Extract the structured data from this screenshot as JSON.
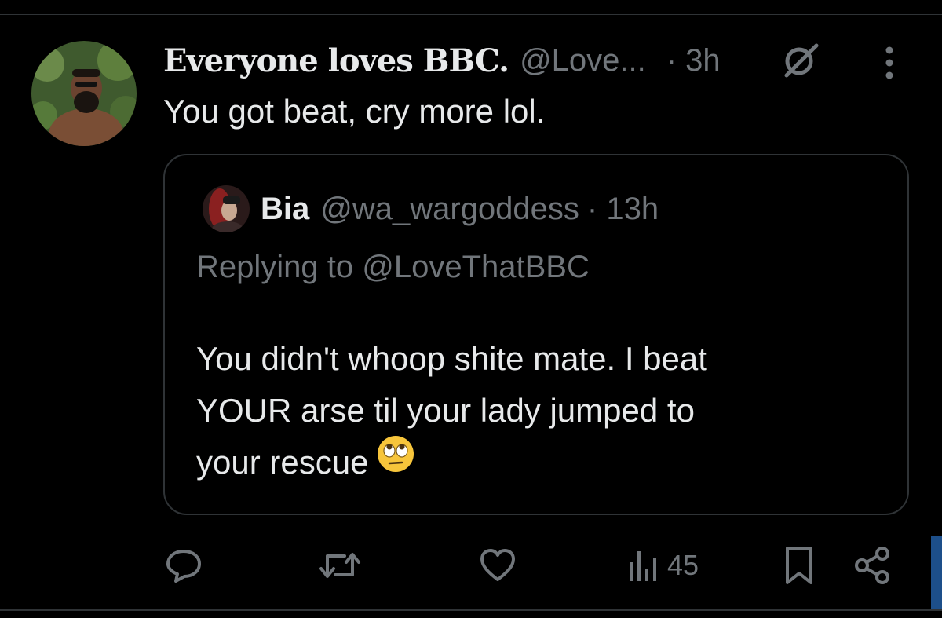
{
  "tweet": {
    "author": {
      "display_name": "Everyone loves BBC.",
      "handle": "@Love...",
      "avatar": "profile-photo"
    },
    "time": "· 3h",
    "text": "You got beat, cry more lol.",
    "quoted": {
      "author": {
        "display_name": "Bia",
        "handle": "@wa_wargoddess",
        "avatar": "profile-photo"
      },
      "time": "· 13h",
      "replying_prefix": "Replying to ",
      "replying_to": "@LoveThatBBC",
      "body_lines": [
        "You didn't whoop shite mate. I beat",
        "YOUR arse til your lady jumped to",
        "your rescue"
      ],
      "emoji": "face-with-rolling-eyes"
    },
    "actions": {
      "reply_icon": "speech-bubble-icon",
      "retweet_icon": "retweet-icon",
      "like_icon": "heart-icon",
      "views_icon": "bar-chart-icon",
      "views_count": "45",
      "bookmark_icon": "bookmark-icon",
      "share_icon": "share-icon"
    }
  },
  "colors": {
    "background": "#000000",
    "primary_text": "#e7e9ea",
    "secondary_text": "#71767b",
    "border": "#2f3336",
    "side_accent": "#1d4f8a"
  }
}
